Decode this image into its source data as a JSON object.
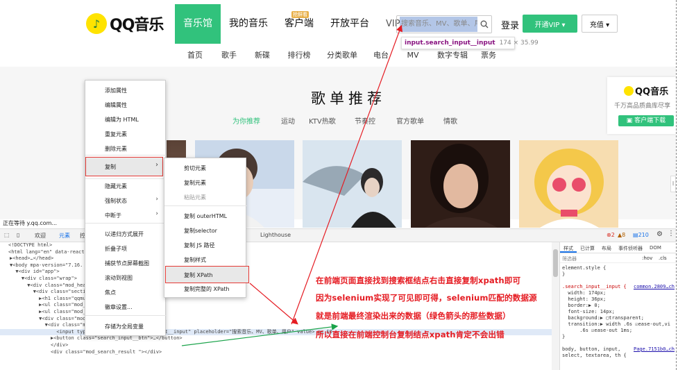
{
  "header": {
    "logo_text": "QQ音乐",
    "nav": [
      {
        "label": "音乐馆",
        "active": true
      },
      {
        "label": "我的音乐"
      },
      {
        "label": "客户端",
        "badge": "抢鲜看"
      },
      {
        "label": "开放平台"
      },
      {
        "label": "VIP"
      }
    ],
    "search_placeholder": "搜索音乐、MV、歌单、用户",
    "login_label": "登录",
    "vip_button": "开通VIP ▾",
    "recharge_button": "充值 ▾",
    "subnav": [
      "首页",
      "歌手",
      "新碟",
      "排行榜",
      "分类歌单",
      "电台",
      "MV",
      "数字专辑",
      "票务"
    ]
  },
  "inspector_tooltip": {
    "selector": "input.search_input__input",
    "size": "174 × 35.99"
  },
  "main": {
    "section_title": "歌单推荐",
    "tabs": [
      "为你推荐",
      "运动",
      "KTV热歌",
      "节奏控",
      "官方歌单",
      "情歌"
    ],
    "active_tab": "为你推荐"
  },
  "ad": {
    "logo": "QQ音乐",
    "slogan": "千万高品质曲库尽享",
    "button": "客户端下载"
  },
  "context_menu": {
    "items": [
      "添加属性",
      "编辑属性",
      "编辑为 HTML",
      "重复元素",
      "删除元素",
      "复制",
      "隐藏元素",
      "强制状态",
      "中断于",
      "以递归方式展开",
      "折叠子项",
      "捕获节点屏幕截图",
      "滚动到视图",
      "焦点",
      "徽章设置...",
      "存储为全局变量"
    ],
    "highlighted": "复制"
  },
  "copy_submenu": {
    "items": [
      "剪切元素",
      "复制元素",
      "粘贴元素",
      "复制 outerHTML",
      "复制selector",
      "复制 JS 路径",
      "复制样式",
      "复制 XPath",
      "复制完整的 XPath"
    ],
    "highlighted": "复制 XPath"
  },
  "devtools": {
    "status_text": "正在等待 y.qq.com...",
    "tabs": [
      "欢迎",
      "元素",
      "控"
    ],
    "active_tab": "元素",
    "lighthouse": "Lighthouse",
    "errors": "2",
    "warnings": "8",
    "messages": "210",
    "code_lines": [
      "<!DOCTYPE html>",
      "<html lang=\"en\" data-react",
      "▶<head>…</head>",
      "▼<body mpa-version=\"7.16.",
      "  ▼<div id=\"app\">",
      "    ▼<div class=\"wrap\">",
      "      ▼<div class=\"mod_hea",
      "        ▼<div class=\"secti",
      "          ▶<h1 class=\"qqmu",
      "          ▶<ul class=\"mod_",
      "          ▶<ul class=\"mod_",
      "          ▼<div class=\"mod",
      "            ▼<div class=\"m",
      "                <input type=\"text\" class=\"search_input__input\" placeholder=\"搜索音乐、MV、歌单、用户\" value> == $0",
      "              ▶<button class=\"search_input__btn\">…</button>",
      "              </div>",
      "              <div class=\"mod_search_result \"></div>"
    ],
    "styles_tabs": [
      "样式",
      "已计算",
      "布局",
      "事件侦听器",
      "DOM"
    ],
    "filter_placeholder": "筛选器",
    "filter_hov": ":hov",
    "filter_cls": ".cls",
    "style_lines": [
      "element.style {",
      "}",
      "",
      ".search_input__input {",
      "  width: 174px;",
      "  height: 36px;",
      "  border:▶ 0;",
      "  font-size: 14px;",
      "  background:▶ ▢transparent;",
      "  transition:▶ width .6s ☑ease-out,vi",
      "      .6s ☑ease-out 1ms;",
      "}",
      "",
      "body, button, input,",
      "select, textarea, th {"
    ],
    "style_link_1": "common.2809…ch",
    "style_link_2": "Page.7151b0…ch"
  },
  "annotation_lines": [
    "在前端页面直接找到搜索框结点右击直接复制xpath即可",
    "因为selenium实现了可见即可得，selenium匹配的数据源",
    "就是前端最终渲染出来的数据（绿色箭头的那些数据）",
    "所以直接在前端控制台复制结点xpath肯定不会出错"
  ],
  "colors": {
    "brand_green": "#31c27c",
    "logo_yellow": "#ffe300",
    "annotation_red": "#e51c23",
    "highlight_blue": "#b3c6e7"
  }
}
